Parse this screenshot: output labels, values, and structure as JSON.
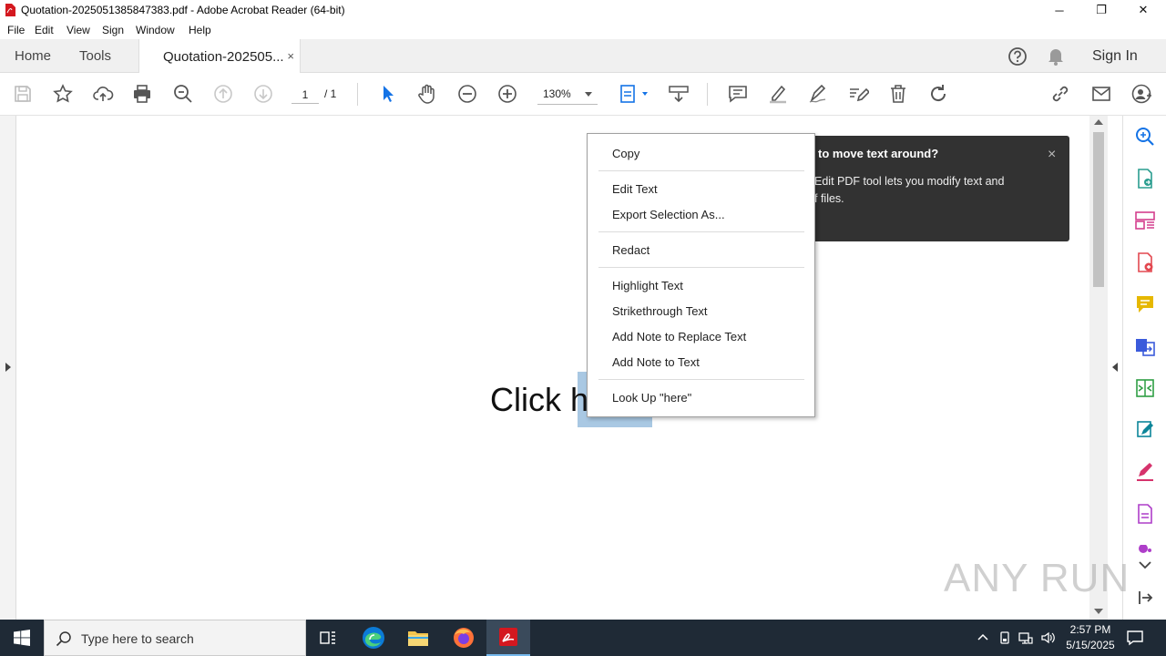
{
  "window": {
    "title": "Quotation-2025051385847383.pdf - Adobe Acrobat Reader (64-bit)",
    "minimize": "─",
    "maximize": "❐",
    "close": "✕"
  },
  "menu": [
    "File",
    "Edit",
    "View",
    "Sign",
    "Window",
    "Help"
  ],
  "tabs": {
    "home": "Home",
    "tools": "Tools",
    "document": "Quotation-202505...",
    "close": "×",
    "sign_in": "Sign In"
  },
  "toolbar": {
    "page_current": "1",
    "page_total": "/ 1",
    "zoom": "130%"
  },
  "document": {
    "text_before": "Click h"
  },
  "tooltip": {
    "title": "to move text around?",
    "body_line1": "Edit PDF tool lets you modify text and",
    "body_line2": "f files.",
    "close": "×"
  },
  "context_menu": {
    "items": [
      "Copy",
      "Edit Text",
      "Export Selection As...",
      "Redact",
      "Highlight Text",
      "Strikethrough Text",
      "Add Note to Replace Text",
      "Add Note to Text",
      "Look Up \"here\""
    ]
  },
  "watermark": "ANY RUN",
  "taskbar": {
    "search_placeholder": "Type here to search",
    "time": "2:57 PM",
    "date": "5/15/2025"
  },
  "colors": {
    "accent": "#1473e6",
    "acrobat_red": "#d4181f",
    "tooltip_bg": "#323232",
    "selection": "#a9c8e3",
    "taskbar_bg": "#1f2a36"
  }
}
